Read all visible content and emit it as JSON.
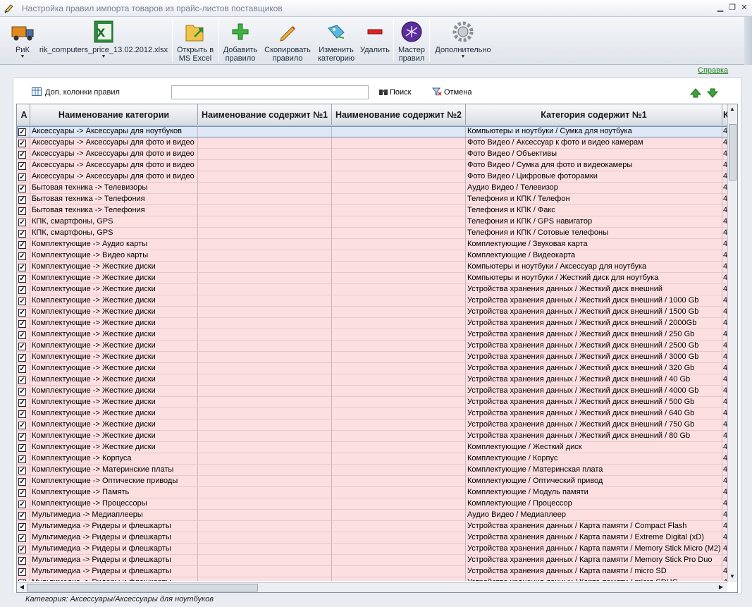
{
  "window": {
    "title": "Настройка правил импорта товаров из прайс-листов поставщиков"
  },
  "ribbon": {
    "rik": "РиК",
    "file": "rik_computers_price_13.02.2012.xlsx",
    "open_excel_l1": "Открыть в",
    "open_excel_l2": "MS Excel",
    "add_l1": "Добавить",
    "add_l2": "правило",
    "copy_l1": "Скопировать",
    "copy_l2": "правило",
    "change_l1": "Изменить",
    "change_l2": "категорию",
    "delete": "Удалить",
    "wizard_l1": "Мастер",
    "wizard_l2": "правил",
    "more": "Дополнительно"
  },
  "help_link": "Справка",
  "toolbar": {
    "extra_columns": "Доп. колонки правил",
    "search_value": "",
    "search": "Поиск",
    "cancel": "Отмена"
  },
  "grid": {
    "headers": [
      "А",
      "Наименование категории",
      "Наименование содержит №1",
      "Наименование содержит №2",
      "Категория содержит №1",
      "К"
    ],
    "last_col_value": "4",
    "rows": [
      [
        "Аксессуары -> Аксессуары для ноутбуков",
        "Компьютеры и ноутбуки / Сумка для ноутбука"
      ],
      [
        "Аксессуары -> Аксессуары для фото и видео",
        "Фото Видео / Аксессуар к фото и видео камерам"
      ],
      [
        "Аксессуары -> Аксессуары для фото и видео",
        "Фото Видео / Объективы"
      ],
      [
        "Аксессуары -> Аксессуары для фото и видео",
        "Фото Видео / Сумка для фото и видеокамеры"
      ],
      [
        "Аксессуары -> Аксессуары для фото и видео",
        "Фото Видео / Цифровые фоторамки"
      ],
      [
        "Бытовая техника -> Телевизоры",
        "Аудио Видео / Телевизор"
      ],
      [
        "Бытовая техника -> Телефония",
        "Телефония и КПК / Телефон"
      ],
      [
        "Бытовая техника -> Телефония",
        "Телефония и КПК / Факс"
      ],
      [
        "КПК, смартфоны, GPS",
        "Телефония и КПК / GPS навигатор"
      ],
      [
        "КПК, смартфоны, GPS",
        "Телефония и КПК / Сотовые телефоны"
      ],
      [
        "Комплектующие -> Аудио карты",
        "Комплектующие / Звуковая карта"
      ],
      [
        "Комплектующие -> Видео карты",
        "Комплектующие / Видеокарта"
      ],
      [
        "Комплектующие -> Жесткие диски",
        "Компьютеры и ноутбуки / Аксессуар для ноутбука"
      ],
      [
        "Комплектующие -> Жесткие диски",
        "Компьютеры и ноутбуки / Жесткий диск для ноутбука"
      ],
      [
        "Комплектующие -> Жесткие диски",
        "Устройства хранения данных / Жесткий диск внешний"
      ],
      [
        "Комплектующие -> Жесткие диски",
        "Устройства хранения данных / Жесткий диск внешний / 1000 Gb"
      ],
      [
        "Комплектующие -> Жесткие диски",
        "Устройства хранения данных / Жесткий диск внешний / 1500 Gb"
      ],
      [
        "Комплектующие -> Жесткие диски",
        "Устройства хранения данных / Жесткий диск внешний / 2000Gb"
      ],
      [
        "Комплектующие -> Жесткие диски",
        "Устройства хранения данных / Жесткий диск внешний / 250 Gb"
      ],
      [
        "Комплектующие -> Жесткие диски",
        "Устройства хранения данных / Жесткий диск внешний / 2500 Gb"
      ],
      [
        "Комплектующие -> Жесткие диски",
        "Устройства хранения данных / Жесткий диск внешний / 3000 Gb"
      ],
      [
        "Комплектующие -> Жесткие диски",
        "Устройства хранения данных / Жесткий диск внешний / 320 Gb"
      ],
      [
        "Комплектующие -> Жесткие диски",
        "Устройства хранения данных / Жесткий диск внешний / 40 Gb"
      ],
      [
        "Комплектующие -> Жесткие диски",
        "Устройства хранения данных / Жесткий диск внешний / 4000 Gb"
      ],
      [
        "Комплектующие -> Жесткие диски",
        "Устройства хранения данных / Жесткий диск внешний / 500 Gb"
      ],
      [
        "Комплектующие -> Жесткие диски",
        "Устройства хранения данных / Жесткий диск внешний / 640 Gb"
      ],
      [
        "Комплектующие -> Жесткие диски",
        "Устройства хранения данных / Жесткий диск внешний / 750 Gb"
      ],
      [
        "Комплектующие -> Жесткие диски",
        "Устройства хранения данных / Жесткий диск внешний / 80 Gb"
      ],
      [
        "Комплектующие -> Жесткие диски",
        "Комплектующие / Жесткий диск"
      ],
      [
        "Комплектующие -> Корпуса",
        "Комплектующие / Корпус"
      ],
      [
        "Комплектующие -> Материнские платы",
        "Комплектующие / Материнская плата"
      ],
      [
        "Комплектующие -> Оптические приводы",
        "Комплектующие / Оптический привод"
      ],
      [
        "Комплектующие -> Память",
        "Комплектующие / Модуль памяти"
      ],
      [
        "Комплектующие -> Процессоры",
        "Комплектующие / Процессор"
      ],
      [
        "Мультимедиа -> Медиаплееры",
        "Аудио Видео / Медиаплеер"
      ],
      [
        "Мультимедиа -> Ридеры и флешкарты",
        "Устройства хранения данных / Карта памяти / Compact Flash"
      ],
      [
        "Мультимедиа -> Ридеры и флешкарты",
        "Устройства хранения данных / Карта памяти / Extreme Digital (xD)"
      ],
      [
        "Мультимедиа -> Ридеры и флешкарты",
        "Устройства хранения данных / Карта памяти / Memory Stick Micro (M2)"
      ],
      [
        "Мультимедиа -> Ридеры и флешкарты",
        "Устройства хранения данных / Карта памяти / Memory Stick Pro Duo"
      ],
      [
        "Мультимедиа -> Ридеры и флешкарты",
        "Устройства хранения данных / Карта памяти / micro SD"
      ],
      [
        "Мультимедиа -> Ридеры и флешкарты",
        "Устройства хранения данных / Карта памяти / micro SDHC"
      ]
    ]
  },
  "status": "Категория: Аксессуары/Аксессуары для ноутбуков"
}
